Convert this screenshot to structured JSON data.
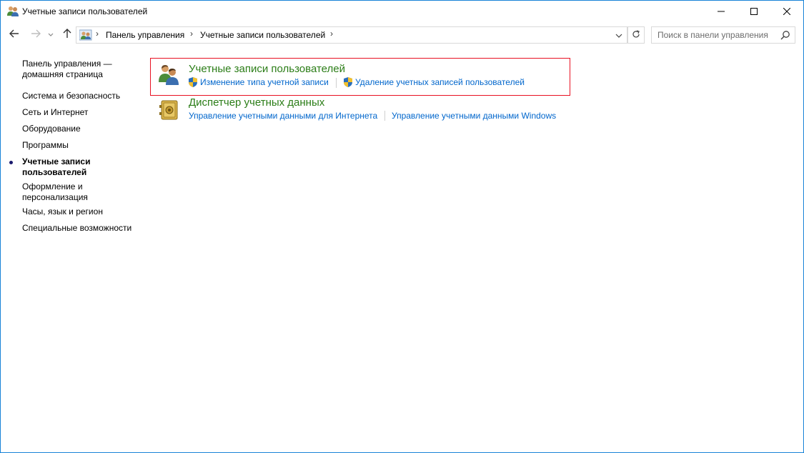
{
  "window": {
    "title": "Учетные записи пользователей",
    "icon": "users-icon",
    "controls": [
      "minimize-icon",
      "maximize-icon",
      "close-icon"
    ]
  },
  "address": {
    "breadcrumbs": [
      "Панель управления",
      "Учетные записи пользователей"
    ],
    "icon": "control-panel-users-icon"
  },
  "search": {
    "placeholder": "Поиск в панели управления"
  },
  "leftnav": {
    "home": "Панель управления — домашняя страница",
    "items": [
      "Система и безопасность",
      "Сеть и Интернет",
      "Оборудование",
      "Программы",
      "Учетные записи пользователей",
      "Оформление и персонализация",
      "Часы, язык и регион",
      "Специальные возможности"
    ],
    "current_index": 4
  },
  "categories": [
    {
      "title": "Учетные записи пользователей",
      "icon": "users-icon",
      "tasks": [
        {
          "label": "Изменение типа учетной записи",
          "shield": true
        },
        {
          "label": "Удаление учетных записей пользователей",
          "shield": true
        }
      ]
    },
    {
      "title": "Диспетчер учетных данных",
      "icon": "credential-vault-icon",
      "tasks": [
        {
          "label": "Управление учетными данными для Интернета",
          "shield": false
        },
        {
          "label": "Управление учетными данными Windows",
          "shield": false
        }
      ]
    }
  ],
  "colors": {
    "category_title": "#2b7d17",
    "link": "#0066cc",
    "highlight_border": "#e81123",
    "window_border": "#1883d7"
  }
}
